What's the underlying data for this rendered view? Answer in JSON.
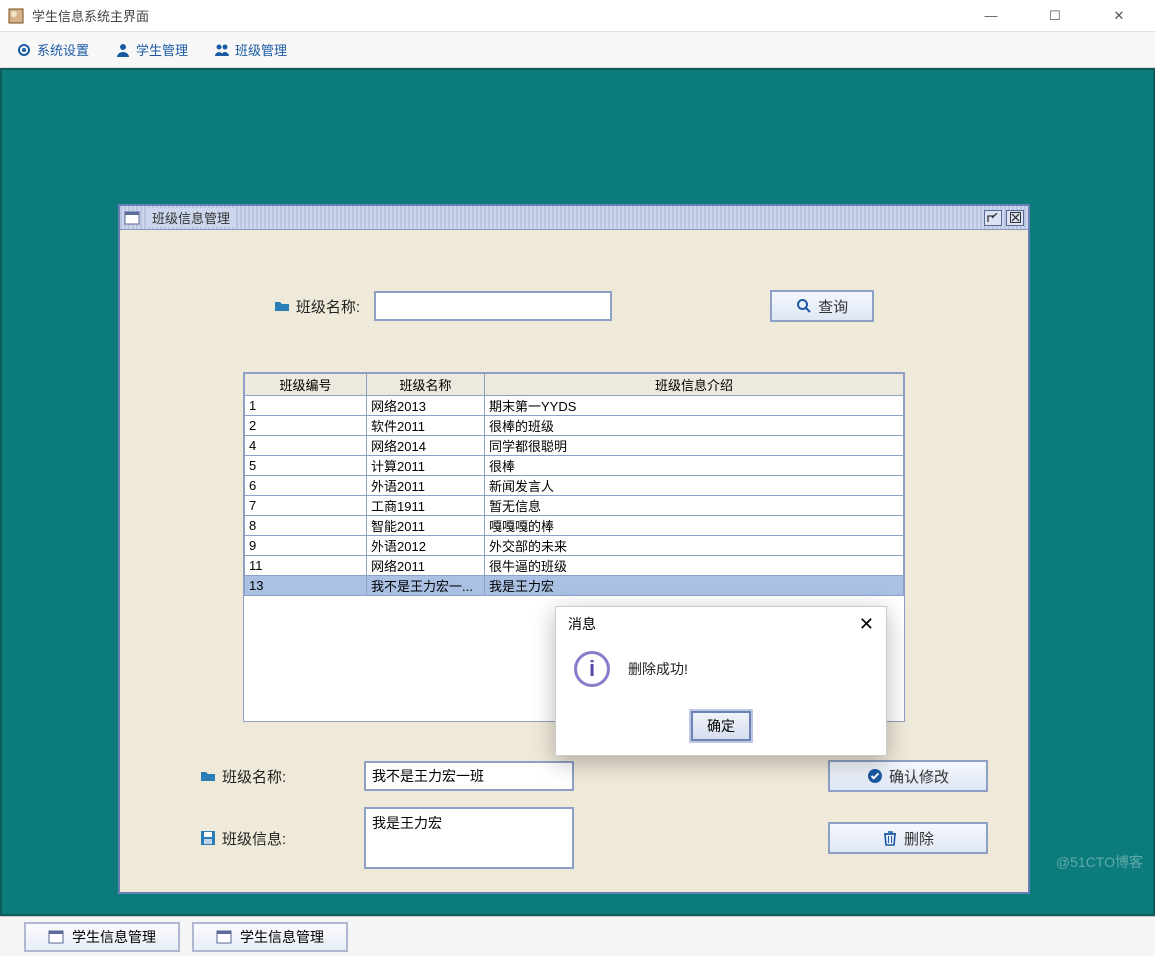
{
  "window": {
    "title": "学生信息系统主界面"
  },
  "menu": {
    "system_settings": "系统设置",
    "student_management": "学生管理",
    "class_management": "班级管理"
  },
  "internal_window": {
    "title": "班级信息管理"
  },
  "search": {
    "label": "班级名称:",
    "value": "",
    "button": "查询"
  },
  "table": {
    "columns": [
      "班级编号",
      "班级名称",
      "班级信息介绍"
    ],
    "rows": [
      {
        "id": "1",
        "name": "网络2013",
        "desc": "期末第一YYDS",
        "selected": false
      },
      {
        "id": "2",
        "name": "软件2011",
        "desc": "很棒的班级",
        "selected": false
      },
      {
        "id": "4",
        "name": "网络2014",
        "desc": "同学都很聪明",
        "selected": false
      },
      {
        "id": "5",
        "name": "计算2011",
        "desc": "很棒",
        "selected": false
      },
      {
        "id": "6",
        "name": "外语2011",
        "desc": "新闻发言人",
        "selected": false
      },
      {
        "id": "7",
        "name": "工商1911",
        "desc": "暂无信息",
        "selected": false
      },
      {
        "id": "8",
        "name": "智能2011",
        "desc": "嘎嘎嘎的棒",
        "selected": false
      },
      {
        "id": "9",
        "name": "外语2012",
        "desc": "外交部的未来",
        "selected": false
      },
      {
        "id": "11",
        "name": "网络2011",
        "desc": "很牛逼的班级",
        "selected": false
      },
      {
        "id": "13",
        "name": "我不是王力宏一...",
        "desc": "我是王力宏",
        "selected": true
      }
    ]
  },
  "form": {
    "name_label": "班级名称:",
    "name_value": "我不是王力宏一班",
    "info_label": "班级信息:",
    "info_value": "我是王力宏",
    "confirm_button": "确认修改",
    "delete_button": "删除"
  },
  "dialog": {
    "title": "消息",
    "message": "删除成功!",
    "ok": "确定"
  },
  "taskbar": {
    "item1": "学生信息管理",
    "item2": "学生信息管理"
  },
  "watermark": "@51CTO博客",
  "colors": {
    "accent": "#1b5aa3",
    "workspace": "#0b7b7b"
  }
}
